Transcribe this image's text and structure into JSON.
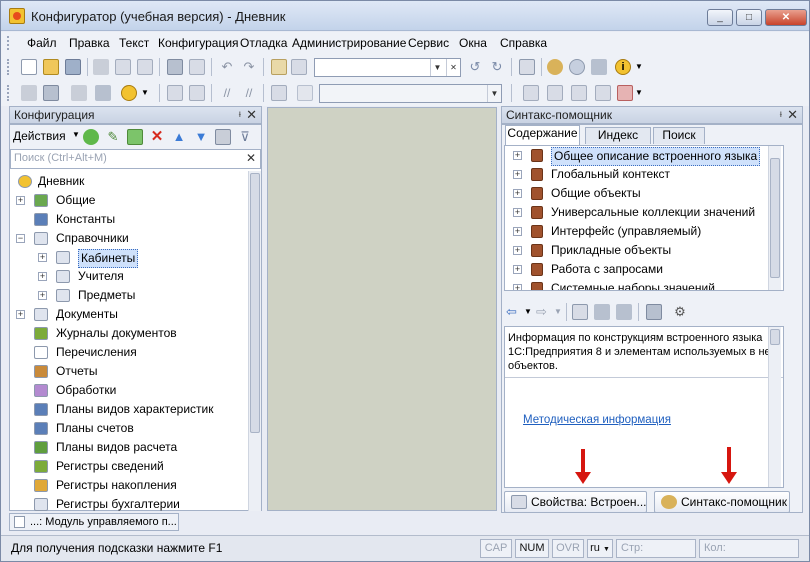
{
  "window": {
    "title": "Конфигуратор (учебная версия) - Дневник",
    "controls": [
      "_",
      "□",
      "✕"
    ]
  },
  "menu": [
    "Файл",
    "Правка",
    "Текст",
    "Конфигурация",
    "Отладка",
    "Администрирование",
    "Сервис",
    "Окна",
    "Справка"
  ],
  "left_panel": {
    "title": "Конфигурация",
    "actions_label": "Действия",
    "search_placeholder": "Поиск (Ctrl+Alt+M)",
    "tree": [
      {
        "label": "Дневник",
        "level": 0,
        "expander": "",
        "icon": "root-icon",
        "selected": false
      },
      {
        "label": "Общие",
        "level": 1,
        "expander": "+",
        "icon": "common-icon",
        "selected": false
      },
      {
        "label": "Константы",
        "level": 1,
        "expander": "",
        "icon": "constants-icon",
        "selected": false
      },
      {
        "label": "Справочники",
        "level": 1,
        "expander": "−",
        "icon": "catalog-icon",
        "selected": false
      },
      {
        "label": "Кабинеты",
        "level": 2,
        "expander": "+",
        "icon": "catalog-icon",
        "selected": true
      },
      {
        "label": "Учителя",
        "level": 2,
        "expander": "+",
        "icon": "catalog-icon",
        "selected": false
      },
      {
        "label": "Предметы",
        "level": 2,
        "expander": "+",
        "icon": "catalog-icon",
        "selected": false
      },
      {
        "label": "Документы",
        "level": 1,
        "expander": "+",
        "icon": "document-icon",
        "selected": false
      },
      {
        "label": "Журналы документов",
        "level": 1,
        "expander": "",
        "icon": "journal-icon",
        "selected": false
      },
      {
        "label": "Перечисления",
        "level": 1,
        "expander": "",
        "icon": "enum-icon",
        "selected": false
      },
      {
        "label": "Отчеты",
        "level": 1,
        "expander": "",
        "icon": "report-icon",
        "selected": false
      },
      {
        "label": "Обработки",
        "level": 1,
        "expander": "",
        "icon": "processing-icon",
        "selected": false
      },
      {
        "label": "Планы видов характеристик",
        "level": 1,
        "expander": "",
        "icon": "chart-types-icon",
        "selected": false
      },
      {
        "label": "Планы счетов",
        "level": 1,
        "expander": "",
        "icon": "accounts-icon",
        "selected": false
      },
      {
        "label": "Планы видов расчета",
        "level": 1,
        "expander": "",
        "icon": "calc-types-icon",
        "selected": false
      },
      {
        "label": "Регистры сведений",
        "level": 1,
        "expander": "",
        "icon": "info-register-icon",
        "selected": false
      },
      {
        "label": "Регистры накопления",
        "level": 1,
        "expander": "",
        "icon": "accum-register-icon",
        "selected": false
      },
      {
        "label": "Регистры бухгалтерии",
        "level": 1,
        "expander": "",
        "icon": "accounting-register-icon",
        "selected": false
      }
    ],
    "bottom_tab": "...: Модуль управляемого п..."
  },
  "syntax_panel": {
    "title": "Синтакс-помощник",
    "tabs": [
      "Содержание",
      "Индекс",
      "Поиск"
    ],
    "topics": [
      {
        "label": "Общее описание встроенного языка",
        "selected": true
      },
      {
        "label": "Глобальный контекст",
        "selected": false
      },
      {
        "label": "Общие объекты",
        "selected": false
      },
      {
        "label": "Универсальные коллекции значений",
        "selected": false
      },
      {
        "label": "Интерфейс (управляемый)",
        "selected": false
      },
      {
        "label": "Прикладные объекты",
        "selected": false
      },
      {
        "label": "Работа с запросами",
        "selected": false
      },
      {
        "label": "Системные наборы значений",
        "selected": false
      }
    ],
    "info_text": "Информация по конструкциям встроенного языка 1С:Предприятия 8 и элементам используемых в нем объектов.",
    "info_link": "Методическая информация",
    "buttons": [
      "Свойства: Встроен...",
      "Синтакс-помощник"
    ]
  },
  "status": {
    "hint": "Для получения подсказки нажмите F1",
    "indicators": [
      "CAP",
      "NUM",
      "OVR"
    ],
    "indicators_on": [
      false,
      true,
      false
    ],
    "lang": "ru",
    "row_label": "Стр:",
    "col_label": "Кол:"
  },
  "colors": {
    "accent_red": "#d6160f",
    "link": "#1f5fbf",
    "selection": "#cfe1fb"
  }
}
